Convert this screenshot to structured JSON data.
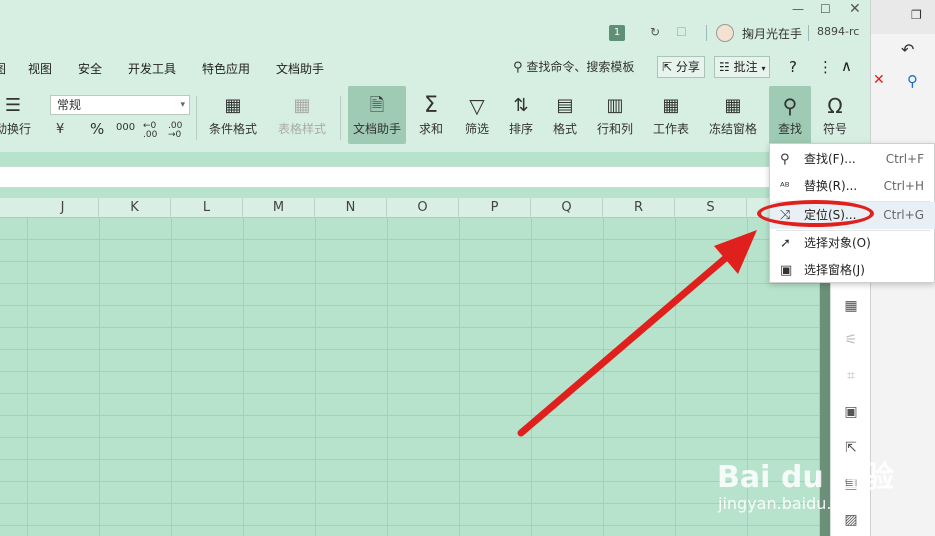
{
  "titlebar": {
    "badge": "1",
    "user_name": "掬月光在手",
    "user_id": "8894-rc",
    "window_icons": [
      "minimize-icon",
      "maximize-icon",
      "close-icon"
    ]
  },
  "menubar": {
    "items": [
      "图",
      "视图",
      "安全",
      "开发工具",
      "特色应用",
      "文档助手"
    ],
    "search_text": "查找命令、搜索模板",
    "share_label": "分享",
    "comment_label": "批注",
    "help_label": "?",
    "more_label": "⋮",
    "collapse_label": "∧"
  },
  "ribbon": {
    "wrap_label": "动换行",
    "number_format": "常规",
    "currency": "¥",
    "percent": "%",
    "thousands": "000",
    "dec_increase": "←0 .00",
    "dec_decrease": ".00 →0",
    "buttons": [
      {
        "label": "条件格式",
        "icon": "conditional-format-icon"
      },
      {
        "label": "表格样式",
        "icon": "table-style-icon"
      },
      {
        "label": "文档助手",
        "icon": "doc-assistant-icon"
      },
      {
        "label": "求和",
        "icon": "sum-icon"
      },
      {
        "label": "筛选",
        "icon": "filter-icon"
      },
      {
        "label": "排序",
        "icon": "sort-icon"
      },
      {
        "label": "格式",
        "icon": "format-icon"
      },
      {
        "label": "行和列",
        "icon": "row-col-icon"
      },
      {
        "label": "工作表",
        "icon": "worksheet-icon"
      },
      {
        "label": "冻结窗格",
        "icon": "freeze-icon"
      },
      {
        "label": "查找",
        "icon": "search-icon"
      },
      {
        "label": "符号",
        "icon": "symbol-icon"
      }
    ]
  },
  "columns": [
    "J",
    "K",
    "L",
    "M",
    "N",
    "O",
    "P",
    "Q",
    "R",
    "S"
  ],
  "dropdown": {
    "items": [
      {
        "label": "查找(F)...",
        "shortcut": "Ctrl+F",
        "icon": "search-icon"
      },
      {
        "label": "替换(R)...",
        "shortcut": "Ctrl+H",
        "icon": "replace-icon"
      },
      {
        "label": "定位(S)...",
        "shortcut": "Ctrl+G",
        "icon": "goto-icon"
      },
      {
        "label": "选择对象(O)",
        "shortcut": "",
        "icon": "cursor-icon"
      },
      {
        "label": "选择窗格(J)",
        "shortcut": "",
        "icon": "selection-pane-icon"
      }
    ]
  },
  "watermark": {
    "text": "Bai du 经验",
    "sub": "jingyan.baidu.com"
  },
  "colors": {
    "accent_red": "#e0201c",
    "sheet_green": "#b7e3cc",
    "ribbon_green": "#d7efe2"
  }
}
